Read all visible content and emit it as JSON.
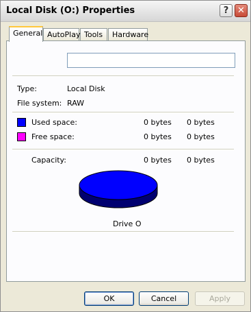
{
  "window": {
    "title": "Local Disk (O:) Properties",
    "help_glyph": "?",
    "close_glyph": "✕"
  },
  "tabs": [
    {
      "label": "General",
      "active": true
    },
    {
      "label": "AutoPlay",
      "active": false
    },
    {
      "label": "Tools",
      "active": false
    },
    {
      "label": "Hardware",
      "active": false
    }
  ],
  "general": {
    "volume_label_value": "",
    "type_label": "Type:",
    "type_value": "Local Disk",
    "fs_label": "File system:",
    "fs_value": "RAW",
    "used_label": "Used space:",
    "used_bytes": "0 bytes",
    "used_size": "0 bytes",
    "free_label": "Free space:",
    "free_bytes": "0 bytes",
    "free_size": "0 bytes",
    "capacity_label": "Capacity:",
    "capacity_bytes": "0 bytes",
    "capacity_size": "0 bytes",
    "drive_caption": "Drive O",
    "used_color": "#0000ff",
    "free_color": "#ff00ff"
  },
  "buttons": {
    "ok": "OK",
    "cancel": "Cancel",
    "apply": "Apply"
  }
}
